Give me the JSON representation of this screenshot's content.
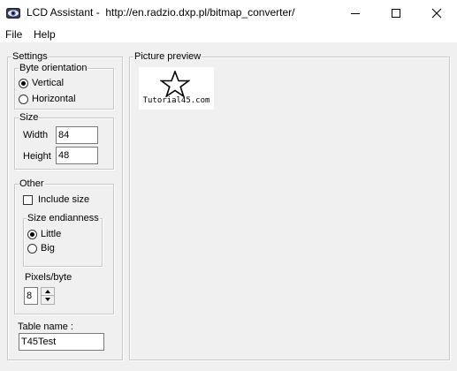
{
  "window": {
    "title": "LCD Assistant -  http://en.radzio.dxp.pl/bitmap_converter/",
    "icon": "lcd-eye-icon"
  },
  "menu": {
    "items": [
      "File",
      "Help"
    ]
  },
  "settings": {
    "legend": "Settings",
    "byte_orientation": {
      "legend": "Byte orientation",
      "options": [
        "Vertical",
        "Horizontal"
      ],
      "selected": "Vertical"
    },
    "size": {
      "legend": "Size",
      "width_label": "Width",
      "width_value": "84",
      "height_label": "Height",
      "height_value": "48"
    },
    "other": {
      "legend": "Other",
      "include_size_label": "Include size",
      "include_size_checked": false,
      "endianness": {
        "legend": "Size endianness",
        "options": [
          "Little",
          "Big"
        ],
        "selected": "Little"
      },
      "pixels_per_byte_label": "Pixels/byte",
      "pixels_per_byte_value": "8"
    },
    "table_name_label": "Table name :",
    "table_name_value": "T45Test"
  },
  "preview": {
    "legend": "Picture preview",
    "image_caption": "Tutorial45.com",
    "image_icon": "star-outline-icon"
  }
}
